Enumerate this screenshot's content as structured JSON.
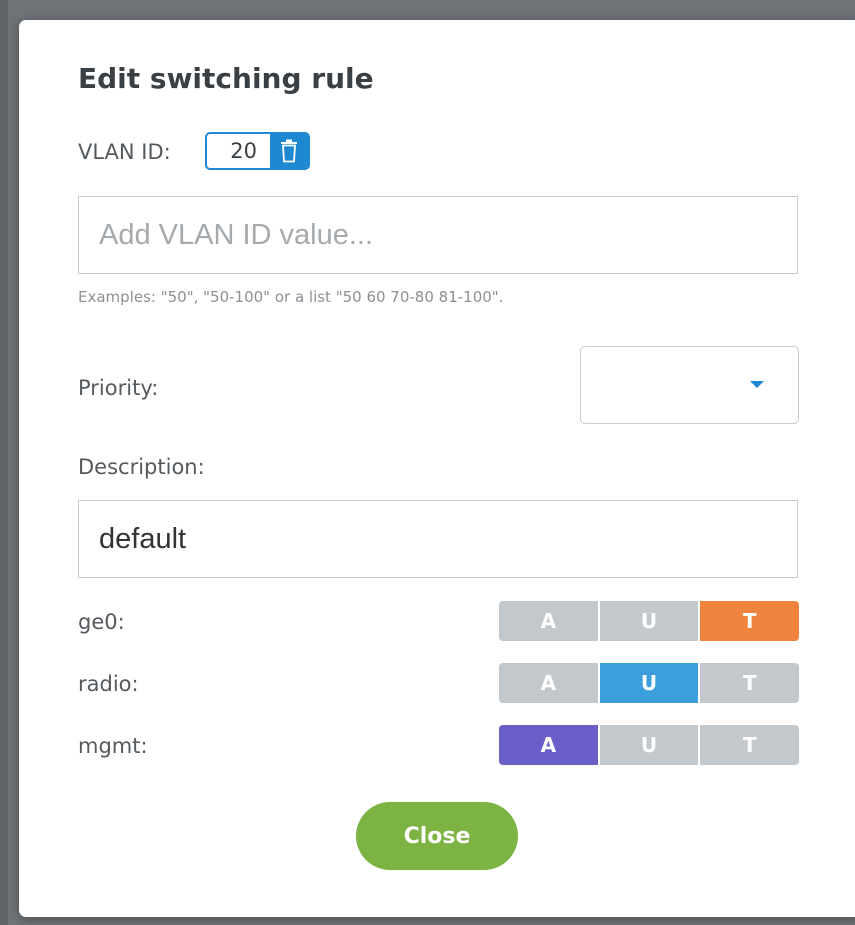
{
  "dialog": {
    "title": "Edit switching rule"
  },
  "vlan": {
    "label": "VLAN ID:",
    "chip_value": "20",
    "add_placeholder": "Add VLAN ID value...",
    "hint": "Examples: \"50\", \"50-100\" or a list \"50 60 70-80 81-100\"."
  },
  "priority": {
    "label": "Priority:",
    "selected": ""
  },
  "description": {
    "label": "Description:",
    "value": "default"
  },
  "interfaces": [
    {
      "name": "ge0:",
      "options": [
        "A",
        "U",
        "T"
      ],
      "active": "T",
      "active_color": "#f0843f"
    },
    {
      "name": "radio:",
      "options": [
        "A",
        "U",
        "T"
      ],
      "active": "U",
      "active_color": "#3b9fdc"
    },
    {
      "name": "mgmt:",
      "options": [
        "A",
        "U",
        "T"
      ],
      "active": "A",
      "active_color": "#6a5fc8"
    }
  ],
  "colors": {
    "accent": "#1e88d2",
    "inactive_segment": "#c3c8cd",
    "close_button": "#7cb342"
  },
  "icons": {
    "chip_delete": "trash-icon",
    "priority_caret": "caret-down-icon"
  },
  "footer": {
    "close_label": "Close"
  }
}
